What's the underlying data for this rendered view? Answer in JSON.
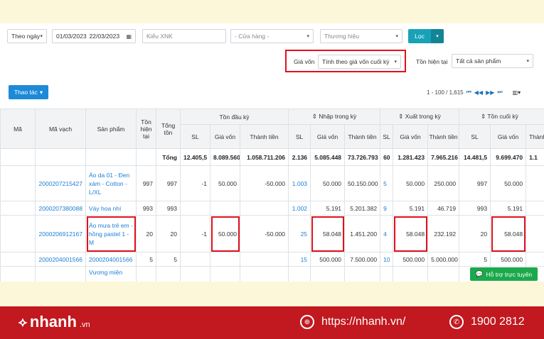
{
  "filters": {
    "period": "Theo ngày",
    "date_from": "01/03/2023",
    "date_to": "22/03/2023",
    "type_placeholder": "Kiểu XNK",
    "store": "- Cửa hàng -",
    "brand": "Thương hiệu",
    "filter_button": "Lọc"
  },
  "cost": {
    "label": "Giá vốn",
    "value": "Tính theo giá vốn cuối kỳ"
  },
  "stock": {
    "label": "Tồn hiện tại",
    "value": "Tất cả sản phẩm"
  },
  "actions_button": "Thao tác",
  "pagination": "1 - 100 / 1,615",
  "headers": {
    "ma": "Mã",
    "ma_vach": "Mã vạch",
    "san_pham": "Sản phẩm",
    "ton_hien_tai": "Tồn hiện tại",
    "tong_ton": "Tổng tồn",
    "ton_dau_ky": "Tồn đầu kỳ",
    "nhap_trong_ky": "⇕ Nhập trong kỳ",
    "xuat_trong_ky": "⇕ Xuất trong kỳ",
    "ton_cuoi_ky": "⇕ Tồn cuối kỳ",
    "sl": "SL",
    "gia_von": "Giá vốn",
    "thanh_tien": "Thành tiền"
  },
  "total_row": {
    "label": "Tổng",
    "cells": [
      "12.405,5",
      "8.089.560",
      "1.058.711.206",
      "2.136",
      "5.085.448",
      "73.726.793",
      "60",
      "1.281.423",
      "7.965.216",
      "14.481,5",
      "9.699.470",
      "1.1"
    ]
  },
  "rows": [
    {
      "barcode": "2000207215427",
      "product": "Áo da 01 - Đen xám - Cotton - L/XL",
      "ton_ht": "997",
      "tong_ton": "997",
      "dk_sl": "-1",
      "dk_gv": "50.000",
      "dk_tt": "-50.000",
      "n_sl": "1.003",
      "n_gv": "50.000",
      "n_tt": "50.150.000",
      "x_sl": "5",
      "x_gv": "50.000",
      "x_tt": "250.000",
      "c_sl": "997",
      "c_gv": "50.000"
    },
    {
      "barcode": "2000207380088",
      "product": "Váy hoa nhí",
      "ton_ht": "993",
      "tong_ton": "993",
      "dk_sl": "",
      "dk_gv": "",
      "dk_tt": "",
      "n_sl": "1.002",
      "n_gv": "5.191",
      "n_tt": "5.201.382",
      "x_sl": "9",
      "x_gv": "5.191",
      "x_tt": "46.719",
      "c_sl": "993",
      "c_gv": "5.191"
    },
    {
      "barcode": "2000206912167",
      "product": "Áo mưa trẻ em - hồng pastel 1 - M",
      "ton_ht": "20",
      "tong_ton": "20",
      "dk_sl": "-1",
      "dk_gv": "50.000",
      "dk_tt": "-50.000",
      "n_sl": "25",
      "n_gv": "58.048",
      "n_tt": "1.451.200",
      "x_sl": "4",
      "x_gv": "58.048",
      "x_tt": "232.192",
      "c_sl": "20",
      "c_gv": "58.048"
    },
    {
      "barcode": "2000204001566",
      "product": "2000204001566",
      "ton_ht": "5",
      "tong_ton": "5",
      "dk_sl": "",
      "dk_gv": "",
      "dk_tt": "",
      "n_sl": "15",
      "n_gv": "500.000",
      "n_tt": "7.500.000",
      "x_sl": "10",
      "x_gv": "500.000",
      "x_tt": "5.000.000",
      "c_sl": "5",
      "c_gv": "500.000"
    },
    {
      "barcode": "",
      "product": "Vương miện",
      "ton_ht": "",
      "tong_ton": "",
      "dk_sl": "",
      "dk_gv": "",
      "dk_tt": "",
      "n_sl": "",
      "n_gv": "",
      "n_tt": "",
      "x_sl": "",
      "x_gv": "",
      "x_tt": "",
      "c_sl": "",
      "c_gv": ""
    }
  ],
  "chat_button": "Hỗ trợ trực tuyến",
  "footer": {
    "brand": "nhanh",
    "brand_suffix": ".vn",
    "website": "https://nhanh.vn/",
    "phone": "1900 2812"
  },
  "colors": {
    "accent_blue": "#1c8ad8",
    "teal": "#17a2b8",
    "highlight_red": "#e0121d",
    "footer_red": "#c2181f",
    "chat_green": "#1ba94c"
  }
}
